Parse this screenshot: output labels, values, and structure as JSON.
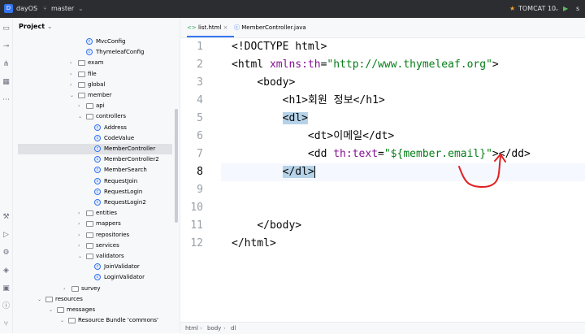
{
  "titlebar": {
    "project_badge": "D",
    "project_name": "dayOS",
    "branch": "master",
    "run_config": "TOMCAT 10",
    "right_extra": "s"
  },
  "project_panel": {
    "title": "Project",
    "items": [
      {
        "label": "MvcConfig",
        "kind": "class"
      },
      {
        "label": "ThymeleafConfig",
        "kind": "class"
      },
      {
        "label": "exam",
        "kind": "folder"
      },
      {
        "label": "file",
        "kind": "folder"
      },
      {
        "label": "global",
        "kind": "folder"
      },
      {
        "label": "member",
        "kind": "folder"
      },
      {
        "label": "api",
        "kind": "folder"
      },
      {
        "label": "controllers",
        "kind": "folder"
      },
      {
        "label": "Address",
        "kind": "class"
      },
      {
        "label": "CodeValue",
        "kind": "class"
      },
      {
        "label": "MemberController",
        "kind": "class"
      },
      {
        "label": "MemberController2",
        "kind": "class"
      },
      {
        "label": "MemberSearch",
        "kind": "class"
      },
      {
        "label": "RequestJoin",
        "kind": "class"
      },
      {
        "label": "RequestLogin",
        "kind": "class"
      },
      {
        "label": "RequestLogin2",
        "kind": "class"
      },
      {
        "label": "entities",
        "kind": "folder"
      },
      {
        "label": "mappers",
        "kind": "folder"
      },
      {
        "label": "repositories",
        "kind": "folder"
      },
      {
        "label": "services",
        "kind": "folder"
      },
      {
        "label": "validators",
        "kind": "folder"
      },
      {
        "label": "JoinValidator",
        "kind": "class"
      },
      {
        "label": "LoginValidator",
        "kind": "class"
      },
      {
        "label": "survey",
        "kind": "folder"
      },
      {
        "label": "resources",
        "kind": "folder"
      },
      {
        "label": "messages",
        "kind": "folder"
      },
      {
        "label": "Resource Bundle 'commons'",
        "kind": "bundle"
      }
    ]
  },
  "tabs": [
    {
      "label": "list.html",
      "close": "×"
    },
    {
      "label": "MemberController.java"
    }
  ],
  "editor": {
    "line_numbers": [
      "1",
      "2",
      "3",
      "4",
      "5",
      "6",
      "7",
      "8",
      "9",
      "10",
      "11",
      "12"
    ],
    "lines": {
      "l1": "<!DOCTYPE html>",
      "l2_open": "<html ",
      "l2_attr": "xmlns:th",
      "l2_eq": "=",
      "l2_val": "\"http://www.thymeleaf.org\"",
      "l2_close": ">",
      "l3": "<body>",
      "l4_open": "<h1>",
      "l4_text": "회원 정보",
      "l4_close": "</h1>",
      "l5": "<dl>",
      "l6_open": "<dt>",
      "l6_text": "이메일",
      "l6_close": "</dt>",
      "l7_open": "<dd ",
      "l7_attr": "th:text",
      "l7_eq": "=",
      "l7_val": "\"${member.email}\"",
      "l7_close": "></dd>",
      "l8": "</dl>",
      "l11": "</body>",
      "l12": "</html>"
    }
  },
  "breadcrumb": [
    "html",
    "body",
    "dl"
  ],
  "colors": {
    "annotation": "#e02020",
    "accent": "#3574f0"
  }
}
